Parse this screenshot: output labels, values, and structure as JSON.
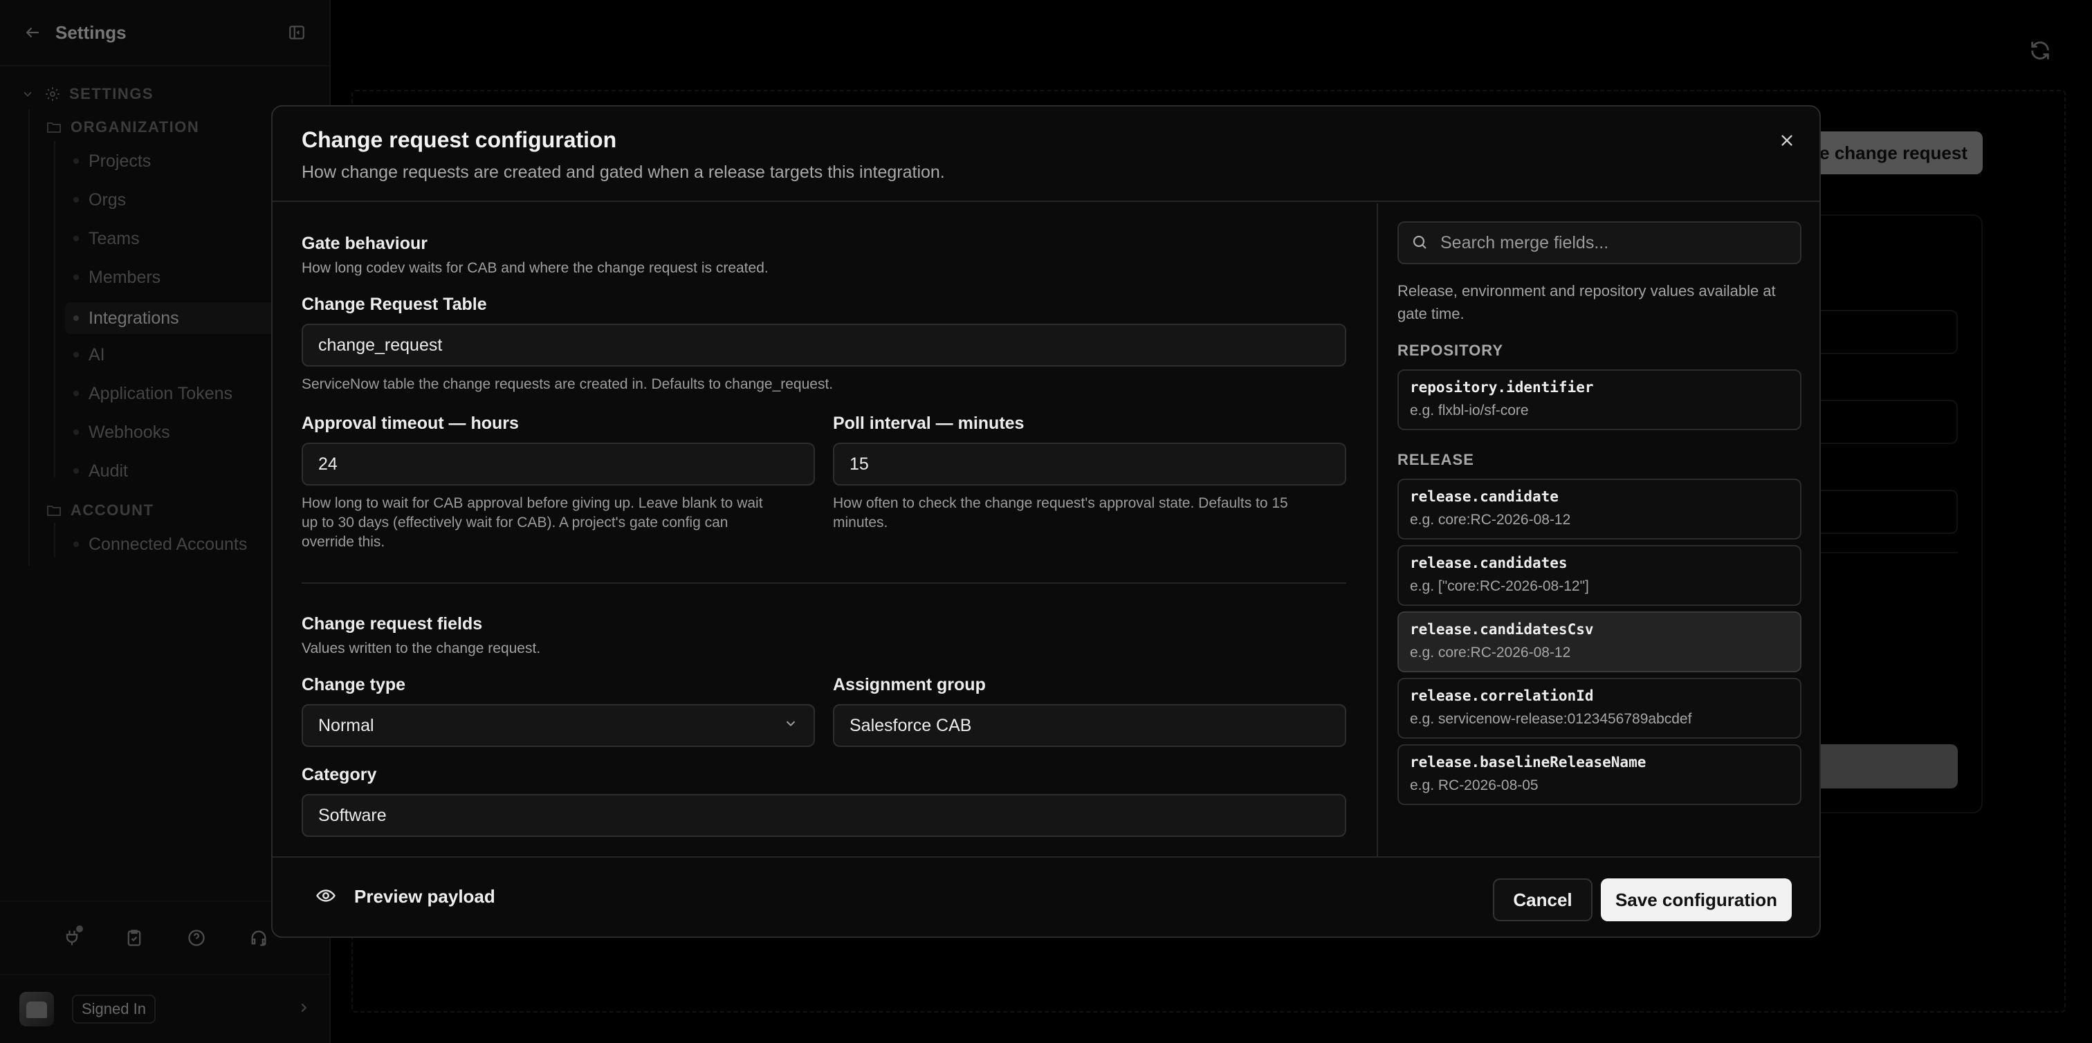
{
  "sidebar": {
    "title": "Settings",
    "sections": {
      "settings": "SETTINGS",
      "organization": "ORGANIZATION",
      "account": "ACCOUNT"
    },
    "items": [
      "Projects",
      "Orgs",
      "Teams",
      "Members",
      "Integrations",
      "AI",
      "Application Tokens",
      "Webhooks",
      "Audit"
    ],
    "active_item": "Integrations",
    "account_items": [
      "Connected Accounts"
    ],
    "user_status": "Signed In"
  },
  "background": {
    "button_label": "re change request"
  },
  "modal": {
    "title": "Change request configuration",
    "subtitle": "How change requests are created and gated when a release targets this integration.",
    "gate": {
      "title": "Gate behaviour",
      "subtitle": "How long codev waits for CAB and where the change request is created.",
      "table_label": "Change Request Table",
      "table_value": "change_request",
      "table_hint": "ServiceNow table the change requests are created in. Defaults to change_request.",
      "timeout_label": "Approval timeout — hours",
      "timeout_value": "24",
      "timeout_hint_1": "How long to wait for CAB approval before giving up. Leave blank to wait",
      "timeout_hint_2": "up to 30 days (effectively wait for CAB). A project's gate config can",
      "timeout_hint_3": "override this.",
      "poll_label": "Poll interval — minutes",
      "poll_value": "15",
      "poll_hint_1": "How often to check the change request's approval state. Defaults to 15",
      "poll_hint_2": "minutes."
    },
    "fields": {
      "title": "Change request fields",
      "subtitle": "Values written to the change request.",
      "type_label": "Change type",
      "type_value": "Normal",
      "group_label": "Assignment group",
      "group_value": "Salesforce CAB",
      "category_label": "Category",
      "category_value": "Software"
    },
    "merge": {
      "search_placeholder": "Search merge fields...",
      "desc_1": "Release, environment and repository values available at",
      "desc_2": "gate time.",
      "repository_title": "REPOSITORY",
      "release_title": "RELEASE",
      "repository": [
        {
          "key": "repository.identifier",
          "example": "e.g. flxbl-io/sf-core"
        }
      ],
      "release": [
        {
          "key": "release.candidate",
          "example": "e.g. core:RC-2026-08-12"
        },
        {
          "key": "release.candidates",
          "example": "e.g. [\"core:RC-2026-08-12\"]"
        },
        {
          "key": "release.candidatesCsv",
          "example": "e.g. core:RC-2026-08-12"
        },
        {
          "key": "release.correlationId",
          "example": "e.g. servicenow-release:0123456789abcdef"
        },
        {
          "key": "release.baselineReleaseName",
          "example": "e.g. RC-2026-08-05"
        }
      ]
    },
    "footer": {
      "preview_label": "Preview payload",
      "cancel_label": "Cancel",
      "save_label": "Save configuration"
    }
  }
}
